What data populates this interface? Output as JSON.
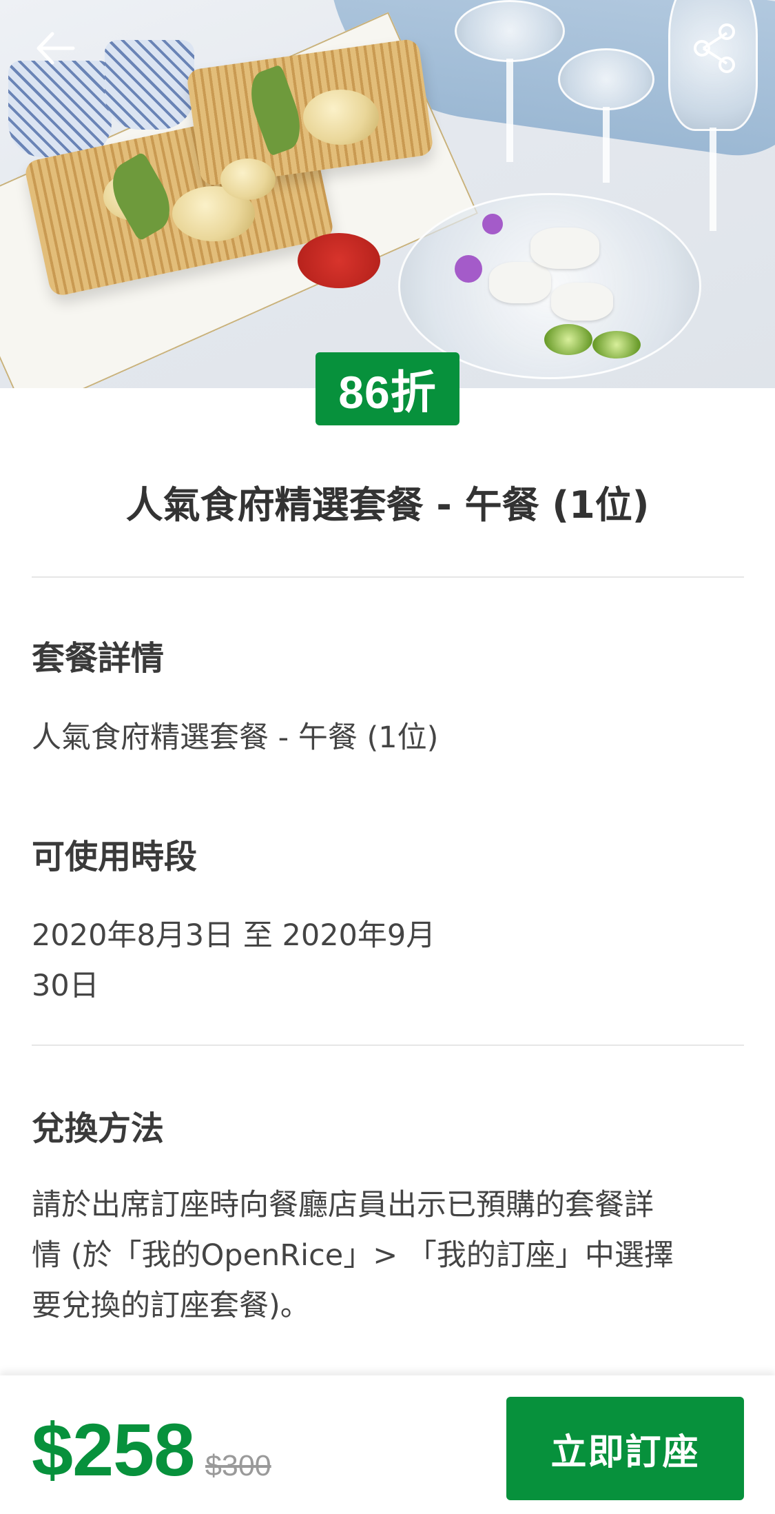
{
  "hero": {
    "discount_badge": "86折"
  },
  "icons": {
    "back": "back-arrow-icon",
    "share": "share-icon"
  },
  "offer": {
    "title": "人氣食府精選套餐 - 午餐 (1位)"
  },
  "sections": {
    "details": {
      "heading": "套餐詳情",
      "text": "人氣食府精選套餐 - 午餐 (1位)"
    },
    "period": {
      "heading": "可使用時段",
      "text_line1": "2020年8月3日 至 2020年9月",
      "text_line2": "30日"
    },
    "redeem": {
      "heading": "兌換方法",
      "text_line1": "請於出席訂座時向餐廳店員出示已預購的套餐詳",
      "text_line2": "情 (於「我的OpenRice」> 「我的訂座」中選擇",
      "text_line3": "要兌換的訂座套餐)。"
    }
  },
  "footer": {
    "price": "$258",
    "original_price": "$300",
    "book_label": "立即訂座"
  },
  "colors": {
    "accent": "#07913c",
    "text": "#333333",
    "muted": "#9a9a9a"
  }
}
